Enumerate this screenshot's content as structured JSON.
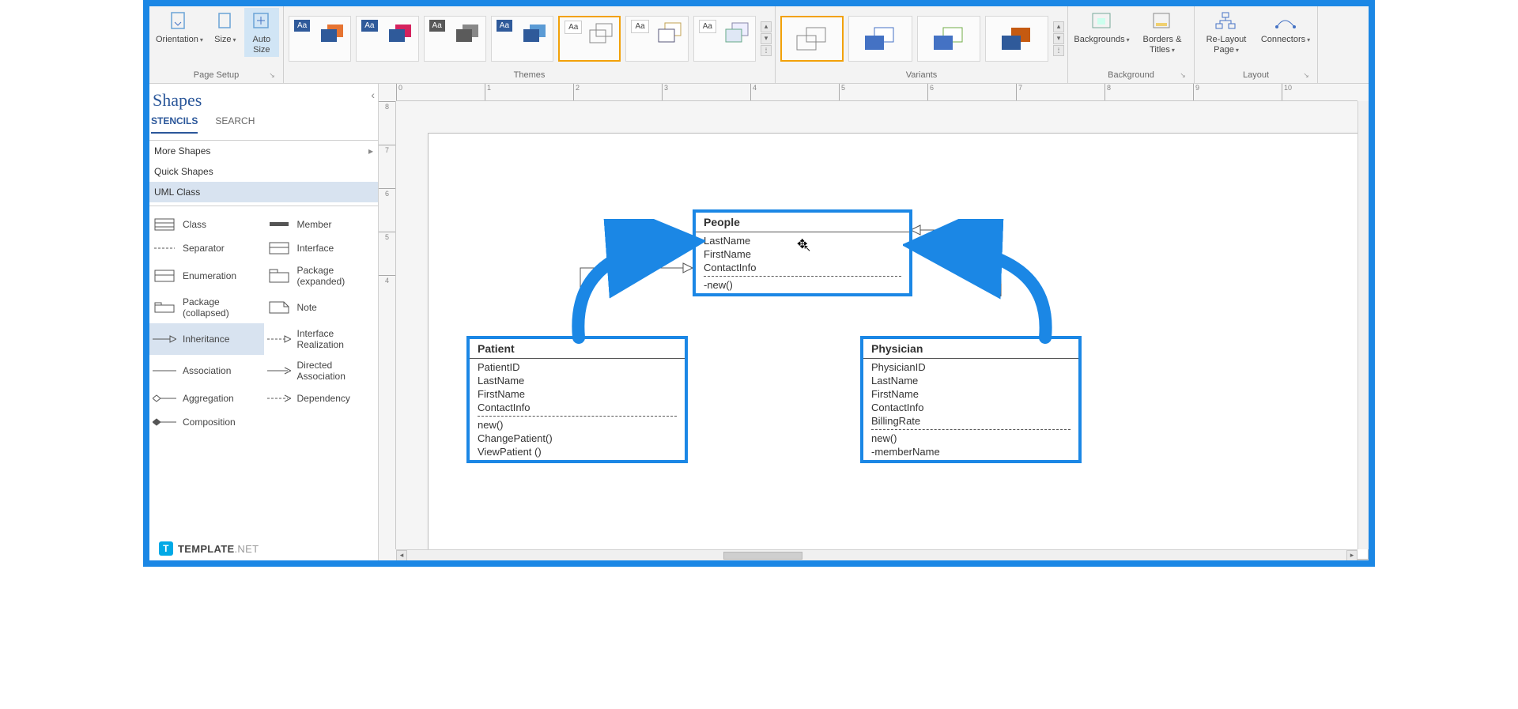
{
  "ribbon": {
    "pageSetup": {
      "orientation": "Orientation",
      "size": "Size",
      "autoSize": "Auto\nSize",
      "label": "Page Setup"
    },
    "themes": {
      "label": "Themes"
    },
    "variants": {
      "label": "Variants"
    },
    "background": {
      "backgrounds": "Backgrounds",
      "borders": "Borders &\nTitles",
      "label": "Background"
    },
    "layout": {
      "relayout": "Re-Layout\nPage",
      "connectors": "Connectors",
      "label": "Layout"
    }
  },
  "shapesPanel": {
    "title": "Shapes",
    "tabs": {
      "stencils": "STENCILS",
      "search": "SEARCH"
    },
    "more": "More Shapes",
    "quick": "Quick Shapes",
    "uml": "UML Class",
    "shapes": {
      "class": "Class",
      "member": "Member",
      "separator": "Separator",
      "interface": "Interface",
      "enumeration": "Enumeration",
      "packageExpanded": "Package\n(expanded)",
      "packageCollapsed": "Package\n(collapsed)",
      "note": "Note",
      "inheritance": "Inheritance",
      "interfaceRealization": "Interface\nRealization",
      "association": "Association",
      "directedAssociation": "Directed\nAssociation",
      "aggregation": "Aggregation",
      "dependency": "Dependency",
      "composition": "Composition"
    }
  },
  "rulerH": [
    "0",
    "1",
    "2",
    "3",
    "4",
    "5",
    "6",
    "7",
    "8",
    "9",
    "10"
  ],
  "rulerV": [
    "8",
    "7",
    "6",
    "5",
    "4"
  ],
  "uml": {
    "people": {
      "title": "People",
      "attrs": [
        "LastName",
        "FirstName",
        "ContactInfo"
      ],
      "ops": [
        "-new()"
      ]
    },
    "patient": {
      "title": "Patient",
      "attrs": [
        "PatientID",
        "LastName",
        "FirstName",
        "ContactInfo"
      ],
      "ops": [
        "new()",
        "ChangePatient()",
        "ViewPatient ()"
      ]
    },
    "physician": {
      "title": "Physician",
      "attrs": [
        "PhysicianID",
        "LastName",
        "FirstName",
        "ContactInfo",
        "BillingRate"
      ],
      "ops": [
        "new()",
        "-memberName"
      ]
    }
  },
  "watermark": {
    "text": "TEMPLATE",
    "suffix": ".NET"
  }
}
